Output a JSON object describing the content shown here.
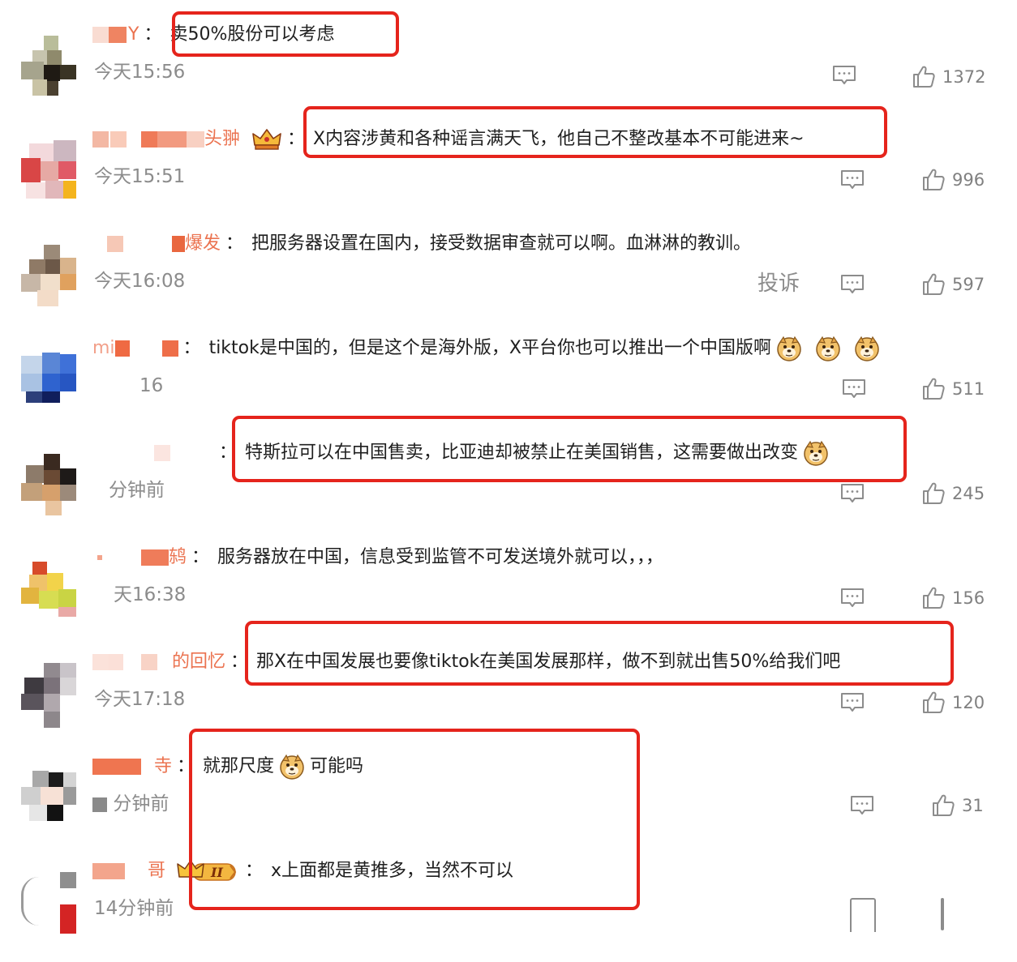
{
  "comments": [
    {
      "name": "Y",
      "text": "卖50%股份可以考虑",
      "time": "今天15:56",
      "likes": "1372"
    },
    {
      "name": "头翀",
      "text": "X内容涉黄和各种谣言满天飞，他自己不整改基本不可能进来~",
      "time": "今天15:51",
      "likes": "996"
    },
    {
      "name": "爆发",
      "text": "把服务器设置在国内，接受数据审查就可以啊。血淋淋的教训。",
      "time": "今天16:08",
      "likes": "597",
      "report": "投诉"
    },
    {
      "name": "mi",
      "text": "tiktok是中国的，但是这个是海外版，X平台你也可以推出一个中国版啊",
      "time": "16",
      "likes": "511"
    },
    {
      "name": "",
      "text": "特斯拉可以在中国售卖，比亚迪却被禁止在美国销售，这需要做出改变",
      "time": "分钟前",
      "likes": "245"
    },
    {
      "name": "鸫",
      "text": "服务器放在中国，信息受到监管不可发送境外就可以，，，",
      "time": "天16:38",
      "likes": "156"
    },
    {
      "name": "的回忆",
      "text": "那X在中国发展也要像tiktok在美国发展那样，做不到就出售50%给我们吧",
      "time": "今天17:18",
      "likes": "120"
    },
    {
      "name": "寺",
      "text_a": "就那尺度",
      "text_b": "可能吗",
      "time": "分钟前",
      "likes": "31"
    },
    {
      "name": "哥",
      "text": "x上面都是黄推多，当然不可以",
      "time": "14分钟前",
      "badge": "II"
    }
  ],
  "colors": {
    "highlight": "#e5241c",
    "username": "#eb7350",
    "meta": "#8c8c8c"
  },
  "icons": [
    "reply-icon",
    "thumbs-up-icon",
    "doge-emoji-icon",
    "crown-badge-icon"
  ]
}
